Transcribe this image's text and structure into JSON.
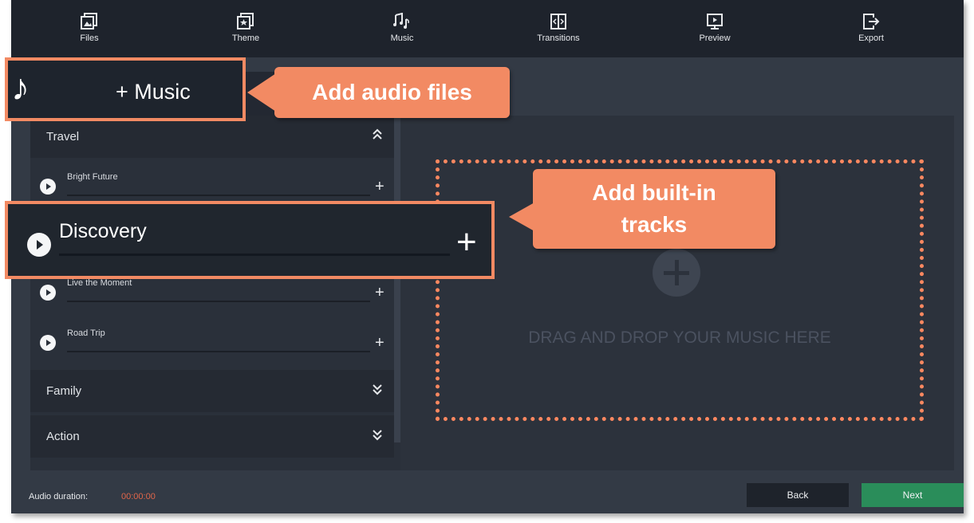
{
  "toolbar": {
    "items": [
      {
        "label": "Files",
        "icon": "files-icon"
      },
      {
        "label": "Theme",
        "icon": "theme-icon"
      },
      {
        "label": "Music",
        "icon": "music-icon"
      },
      {
        "label": "Transitions",
        "icon": "transitions-icon"
      },
      {
        "label": "Preview",
        "icon": "preview-icon"
      },
      {
        "label": "Export",
        "icon": "export-icon"
      }
    ]
  },
  "music_button": {
    "label": "+ Music",
    "icon": "music-note-icon"
  },
  "sections": [
    {
      "title": "Travel",
      "state": "expanded"
    },
    {
      "title": "Family",
      "state": "collapsed"
    },
    {
      "title": "Action",
      "state": "collapsed"
    }
  ],
  "tracks": [
    {
      "name": "Bright Future"
    },
    {
      "name": "Discovery"
    },
    {
      "name": "Live the Moment"
    },
    {
      "name": "Road Trip"
    }
  ],
  "drop_area": {
    "text": "DRAG AND DROP YOUR MUSIC HERE"
  },
  "footer": {
    "duration_label": "Audio duration:",
    "duration_value": "00:00:00",
    "back_label": "Back",
    "next_label": "Next"
  },
  "callouts": {
    "audio_files": "Add audio files",
    "builtin_line1": "Add built-in",
    "builtin_line2": "tracks"
  },
  "colors": {
    "accent": "#f28a63",
    "next_button": "#2a8d5a",
    "duration_value": "#e2664a"
  }
}
